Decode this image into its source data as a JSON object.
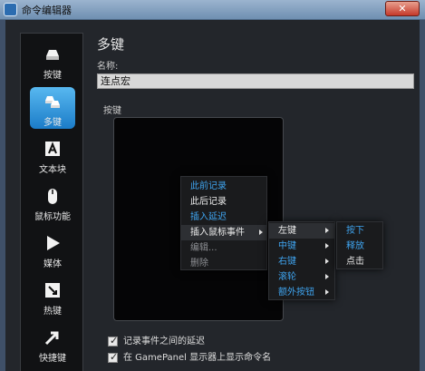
{
  "window": {
    "title": "命令编辑器",
    "close_glyph": "✕"
  },
  "sidebar": {
    "items": [
      {
        "label": "按键",
        "icon": "key-icon"
      },
      {
        "label": "多键",
        "icon": "multikey-icon",
        "active": true
      },
      {
        "label": "文本块",
        "icon": "text-block-icon"
      },
      {
        "label": "鼠标功能",
        "icon": "mouse-icon"
      },
      {
        "label": "媒体",
        "icon": "play-icon"
      },
      {
        "label": "热键",
        "icon": "hotkey-icon"
      },
      {
        "label": "快捷键",
        "icon": "shortcut-arrow-icon"
      }
    ]
  },
  "main": {
    "heading": "多键",
    "name_label": "名称:",
    "name_value": "连点宏",
    "keys_label": "按键"
  },
  "context_menu": {
    "items": [
      {
        "label": "此前记录",
        "style": "blue"
      },
      {
        "label": "此后记录",
        "style": "white"
      },
      {
        "label": "插入延迟",
        "style": "blue"
      },
      {
        "label": "插入鼠标事件",
        "style": "white",
        "submenu": true
      },
      {
        "label": "编辑...",
        "style": "gray"
      },
      {
        "label": "删除",
        "style": "gray"
      }
    ]
  },
  "mouse_submenu": {
    "items": [
      {
        "label": "左键",
        "style": "white",
        "submenu": true
      },
      {
        "label": "中键",
        "style": "blue",
        "submenu": true
      },
      {
        "label": "右键",
        "style": "blue",
        "submenu": true
      },
      {
        "label": "滚轮",
        "style": "blue",
        "submenu": true
      },
      {
        "label": "额外按钮",
        "style": "blue",
        "submenu": true
      }
    ]
  },
  "left_submenu": {
    "items": [
      {
        "label": "按下",
        "style": "blue"
      },
      {
        "label": "释放",
        "style": "blue"
      },
      {
        "label": "点击",
        "style": "white"
      }
    ]
  },
  "options": {
    "record_delay": "记录事件之间的延迟",
    "show_gamepanel": "在 GamePanel 显示器上显示命令名"
  },
  "colors": {
    "accent": "#2a8fdc",
    "menu_blue": "#3fa4ef",
    "background": "#23262b"
  }
}
